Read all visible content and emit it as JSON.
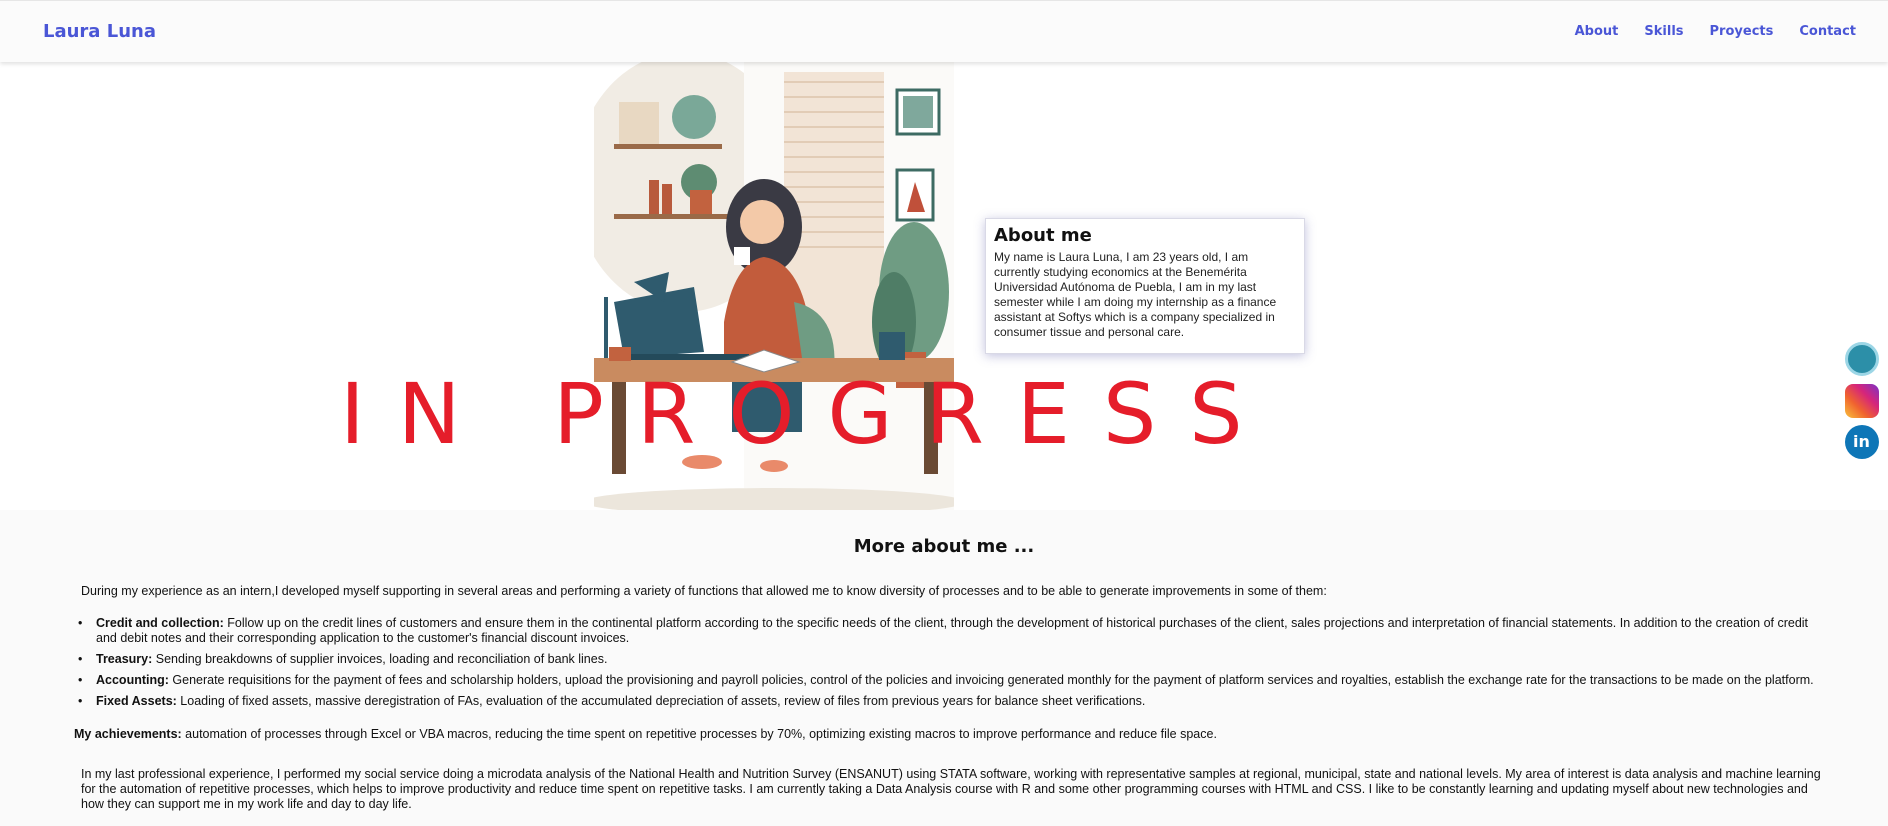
{
  "header": {
    "brand": "Laura Luna",
    "nav": [
      "About",
      "Skills",
      "Proyects",
      "Contact"
    ]
  },
  "hero": {
    "overlay_text": "IN PROGRESS",
    "overlay_color": "#e51d2a",
    "about": {
      "title": "About me",
      "body": "My name is Laura Luna, I am 23 years old, I am currently studying economics at the Benemérita Universidad Autónoma de Puebla, I am in my last semester while I am doing my internship as a finance assistant at Softys which is a company specialized in consumer tissue and personal care."
    }
  },
  "social": [
    {
      "name": "github",
      "icon": "github-icon"
    },
    {
      "name": "instagram",
      "icon": "instagram-icon"
    },
    {
      "name": "linkedin",
      "icon": "linkedin-icon"
    }
  ],
  "more": {
    "title": "More about me ...",
    "intro": "During my experience as an intern,I developed myself supporting in several areas and performing a variety of functions that allowed me to know diversity of processes and to be able to generate improvements in some of them:",
    "items": [
      {
        "label": "Credit and collection:",
        "text": " Follow up on the credit lines of customers and ensure them in the continental platform according to the specific needs of the client, through the development of historical purchases of the client, sales projections and interpretation of financial statements. In addition to the creation of credit and debit notes and their corresponding application to the customer's financial discount invoices."
      },
      {
        "label": "Treasury:",
        "text": " Sending breakdowns of supplier invoices, loading and reconciliation of bank lines."
      },
      {
        "label": "Accounting:",
        "text": " Generate requisitions for the payment of fees and scholarship holders, upload the provisioning and payroll policies, control of the policies and invoicing generated monthly for the payment of platform services and royalties, establish the exchange rate for the transactions to be made on the platform."
      },
      {
        "label": "Fixed Assets:",
        "text": " Loading of fixed assets, massive deregistration of FAs, evaluation of the accumulated depreciation of assets, review of files from previous years for balance sheet verifications."
      }
    ],
    "achievements_label": "My achievements:",
    "achievements_text": " automation of processes through Excel or VBA macros, reducing the time spent on repetitive processes by 70%, optimizing existing macros to improve performance and reduce file space.",
    "final": "In my last professional experience, I performed my social service doing a microdata analysis of the National Health and Nutrition Survey (ENSANUT) using STATA software, working with representative samples at regional, municipal, state and national levels. My area of interest is data analysis and machine learning for the automation of repetitive processes, which helps to improve productivity and reduce time spent on repetitive tasks. I am currently taking a Data Analysis course with R and some other programming courses with HTML and CSS. I like to be constantly learning and updating myself about new technologies and how they can support me in my work life and day to day life."
  }
}
